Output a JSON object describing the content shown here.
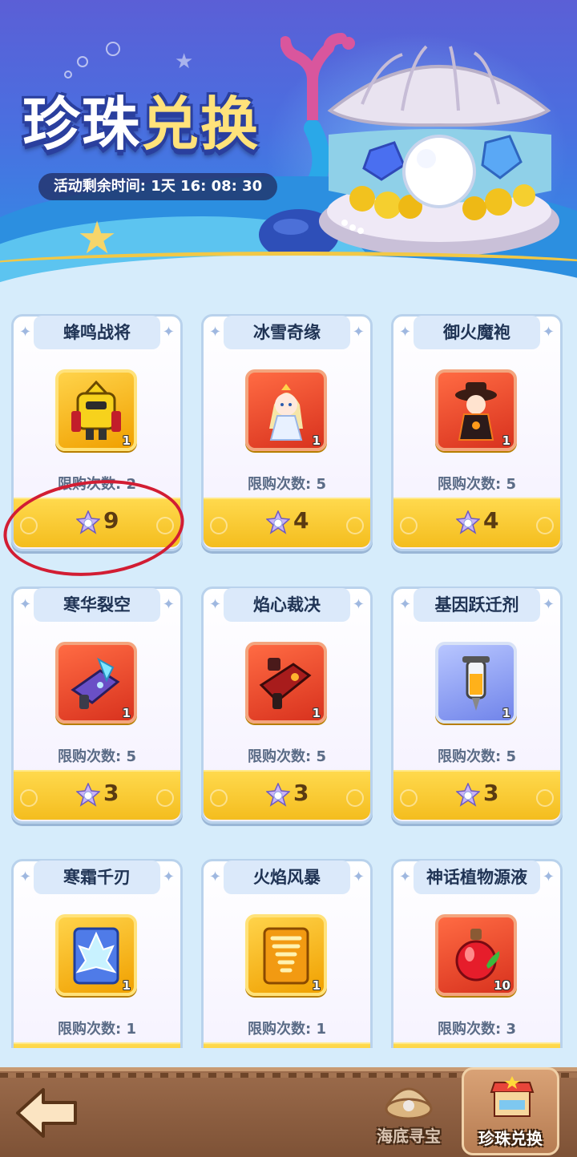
{
  "banner": {
    "title_part1": "珍珠",
    "title_part2": "兑换",
    "timer_label": "活动剩余时间:",
    "timer_value": "1天 16: 08: 30"
  },
  "currency_icon": "pearl-star-icon",
  "items": [
    {
      "name": "蜂鸣战将",
      "limit_label": "限购次数: 2",
      "price": "9",
      "qty": "1",
      "frame": "gold",
      "icon": "robot-mech-icon"
    },
    {
      "name": "冰雪奇缘",
      "limit_label": "限购次数: 5",
      "price": "4",
      "qty": "1",
      "frame": "red",
      "icon": "ice-princess-icon"
    },
    {
      "name": "御火魔袍",
      "limit_label": "限购次数: 5",
      "price": "4",
      "qty": "1",
      "frame": "red",
      "icon": "fire-mage-icon"
    },
    {
      "name": "寒华裂空",
      "limit_label": "限购次数: 5",
      "price": "3",
      "qty": "1",
      "frame": "red",
      "icon": "ice-gun-icon"
    },
    {
      "name": "焰心裁决",
      "limit_label": "限购次数: 5",
      "price": "3",
      "qty": "1",
      "frame": "red",
      "icon": "flame-gun-icon"
    },
    {
      "name": "基因跃迁剂",
      "limit_label": "限购次数: 5",
      "price": "3",
      "qty": "1",
      "frame": "blue",
      "icon": "syringe-icon"
    },
    {
      "name": "寒霜千刃",
      "limit_label": "限购次数: 1",
      "price": "",
      "qty": "1",
      "frame": "gold",
      "icon": "ice-crystal-card-icon"
    },
    {
      "name": "火焰风暴",
      "limit_label": "限购次数: 1",
      "price": "",
      "qty": "1",
      "frame": "gold",
      "icon": "fire-tornado-card-icon"
    },
    {
      "name": "神话植物源液",
      "limit_label": "限购次数: 3",
      "price": "",
      "qty": "10",
      "frame": "red",
      "icon": "potion-bottle-icon"
    }
  ],
  "bottom_nav": {
    "back_icon": "back-arrow-icon",
    "tabs": [
      {
        "label": "海底寻宝",
        "icon": "shell-treasure-icon",
        "active": false
      },
      {
        "label": "珍珠兑换",
        "icon": "shop-stall-icon",
        "active": true
      }
    ]
  },
  "colors": {
    "background": "#d6ecfb",
    "price_bar": "#f4bd1e",
    "annotation": "#d21d33",
    "wood": "#8a5c3e"
  }
}
